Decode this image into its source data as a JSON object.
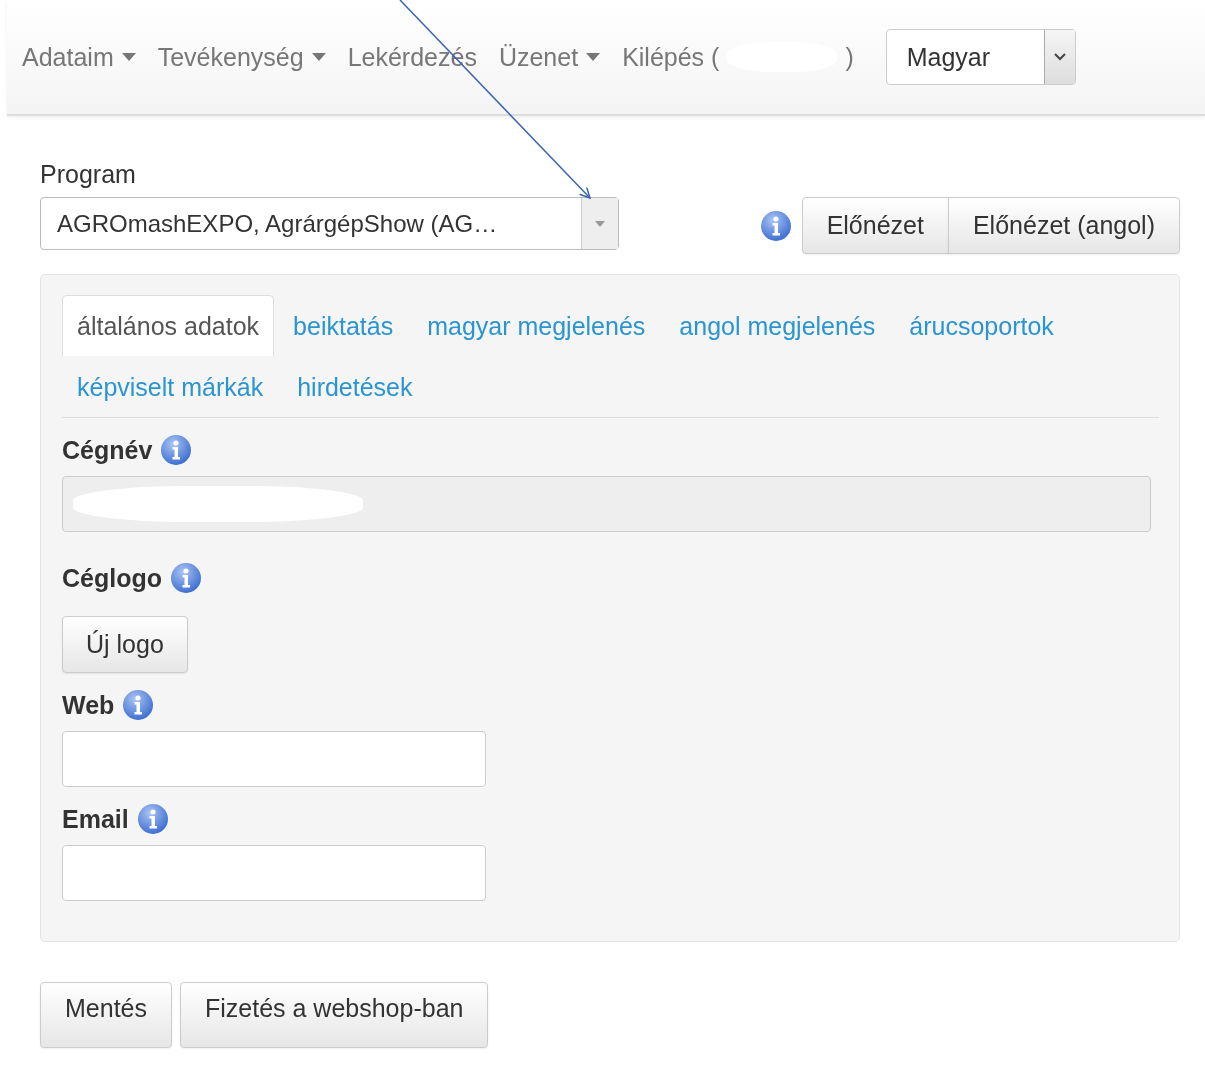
{
  "nav": {
    "items": [
      {
        "label": "Adataim",
        "dropdown": true,
        "redacted": false
      },
      {
        "label": "Tevékenység",
        "dropdown": true,
        "redacted": false
      },
      {
        "label": "Lekérdezés",
        "dropdown": false,
        "redacted": false
      },
      {
        "label": "Üzenet",
        "dropdown": true,
        "redacted": false
      },
      {
        "label": "Kilépés (",
        "dropdown": false,
        "redacted": true,
        "suffix": ")"
      }
    ],
    "language": {
      "value": "Magyar"
    }
  },
  "program": {
    "label": "Program",
    "value": "AGROmashEXPO, AgrárgépShow (AG…"
  },
  "preview_buttons": [
    "Előnézet",
    "Előnézet (angol)"
  ],
  "tabs": [
    {
      "label": "általános adatok",
      "selected": true
    },
    {
      "label": "beiktatás",
      "selected": false
    },
    {
      "label": "magyar megjelenés",
      "selected": false
    },
    {
      "label": "angol megjelenés",
      "selected": false
    },
    {
      "label": "árucsoportok",
      "selected": false
    },
    {
      "label": "képviselt márkák",
      "selected": false
    },
    {
      "label": "hirdetések",
      "selected": false
    }
  ],
  "fields": [
    {
      "kind": "text",
      "label": "Cégnév",
      "disabled": true,
      "redacted": true
    },
    {
      "kind": "upload",
      "label": "Céglogo",
      "button": "Új logo"
    },
    {
      "kind": "text",
      "label": "Web",
      "disabled": false
    },
    {
      "kind": "text",
      "label": "Email",
      "disabled": false
    }
  ],
  "actions": [
    "Mentés",
    "Fizetés a webshop-ban"
  ]
}
